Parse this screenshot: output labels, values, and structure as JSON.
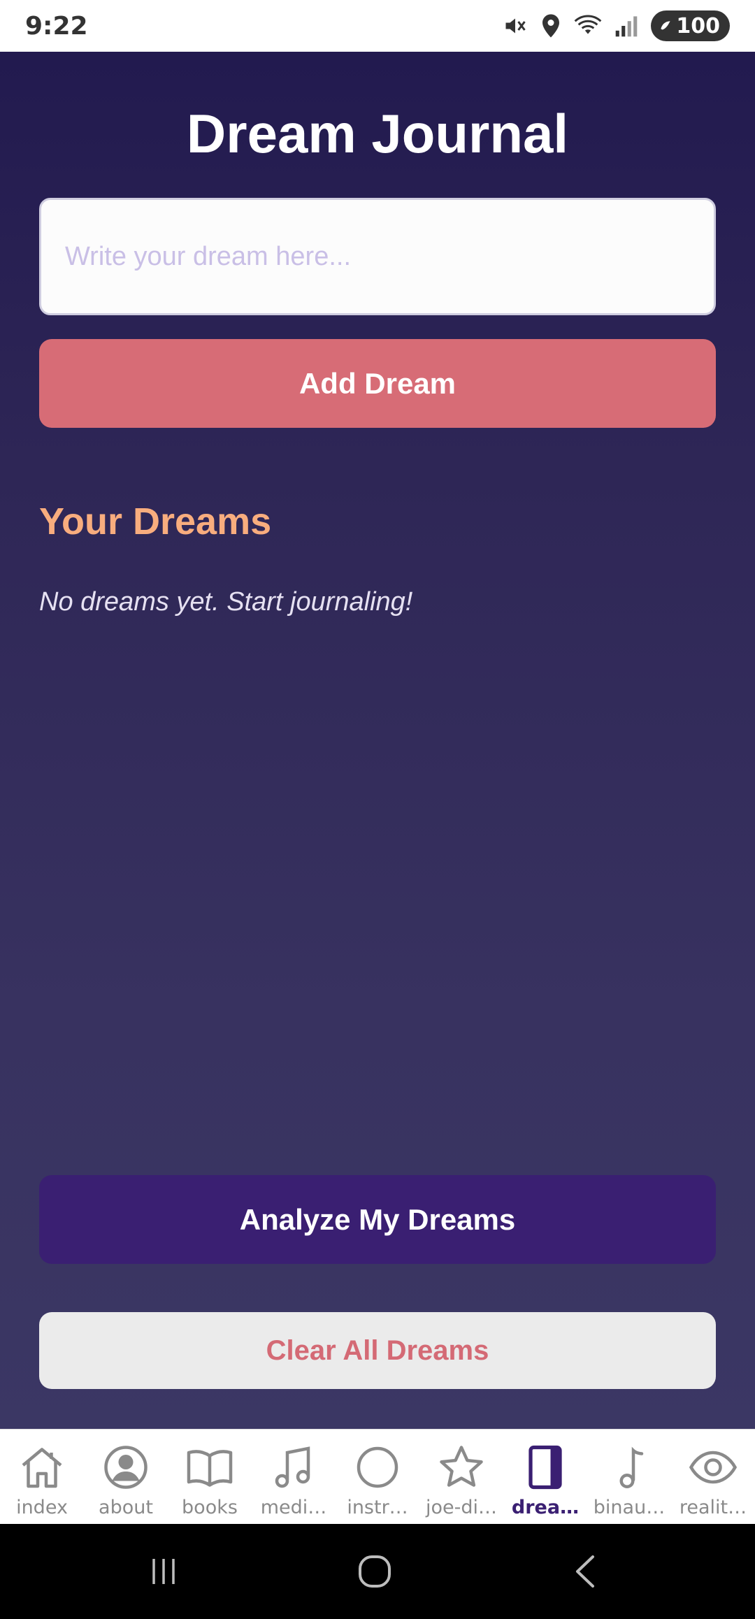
{
  "status_bar": {
    "time": "9:22",
    "battery": "100"
  },
  "title": "Dream Journal",
  "dream_input": {
    "placeholder": "Write your dream here...",
    "value": ""
  },
  "add_button": "Add Dream",
  "dreams_section": {
    "title": "Your Dreams",
    "empty_message": "No dreams yet. Start journaling!"
  },
  "analyze_button": "Analyze My Dreams",
  "clear_button": "Clear All Dreams",
  "tabs": [
    {
      "label": "index",
      "icon": "home-icon"
    },
    {
      "label": "about",
      "icon": "user-circle-icon"
    },
    {
      "label": "books",
      "icon": "book-icon"
    },
    {
      "label": "medi…",
      "icon": "music-note-icon"
    },
    {
      "label": "instr…",
      "icon": "circle-icon"
    },
    {
      "label": "joe-di…",
      "icon": "star-icon"
    },
    {
      "label": "drea…",
      "icon": "journal-icon",
      "active": true
    },
    {
      "label": "binau…",
      "icon": "single-note-icon"
    },
    {
      "label": "realit…",
      "icon": "eye-icon"
    }
  ],
  "colors": {
    "background_top": "#221a4f",
    "background_bottom": "#3b3764",
    "accent_pink": "#d76c76",
    "heading_orange": "#f8ad7e",
    "analyze_purple": "#3a1f72",
    "tab_active": "#3a1f72",
    "tab_inactive": "#8a8a8a"
  }
}
